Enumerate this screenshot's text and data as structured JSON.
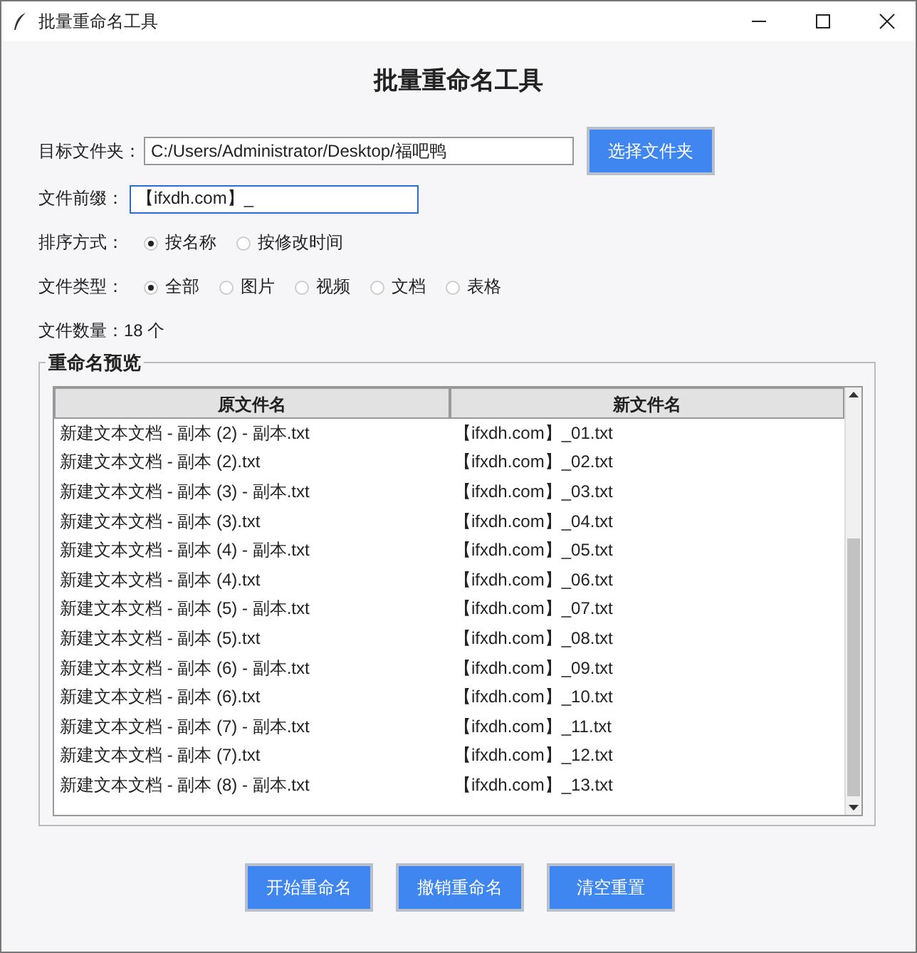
{
  "window": {
    "title": "批量重命名工具"
  },
  "heading": "批量重命名工具",
  "folder": {
    "label": "目标文件夹：",
    "value": "C:/Users/Administrator/Desktop/福吧鸭",
    "button": "选择文件夹"
  },
  "prefix": {
    "label": "文件前缀：",
    "value": "【ifxdh.com】_"
  },
  "sort": {
    "label": "排序方式：",
    "options": [
      {
        "label": "按名称",
        "selected": true
      },
      {
        "label": "按修改时间",
        "selected": false
      }
    ]
  },
  "file_type": {
    "label": "文件类型：",
    "options": [
      {
        "label": "全部",
        "selected": true
      },
      {
        "label": "图片",
        "selected": false
      },
      {
        "label": "视频",
        "selected": false
      },
      {
        "label": "文档",
        "selected": false
      },
      {
        "label": "表格",
        "selected": false
      }
    ]
  },
  "count": "文件数量：18 个",
  "preview": {
    "title": "重命名预览",
    "columns": [
      "原文件名",
      "新文件名"
    ],
    "rows": [
      [
        "新建文本文档 - 副本 (2) - 副本.txt",
        "【ifxdh.com】_01.txt"
      ],
      [
        "新建文本文档 - 副本 (2).txt",
        "【ifxdh.com】_02.txt"
      ],
      [
        "新建文本文档 - 副本 (3) - 副本.txt",
        "【ifxdh.com】_03.txt"
      ],
      [
        "新建文本文档 - 副本 (3).txt",
        "【ifxdh.com】_04.txt"
      ],
      [
        "新建文本文档 - 副本 (4) - 副本.txt",
        "【ifxdh.com】_05.txt"
      ],
      [
        "新建文本文档 - 副本 (4).txt",
        "【ifxdh.com】_06.txt"
      ],
      [
        "新建文本文档 - 副本 (5) - 副本.txt",
        "【ifxdh.com】_07.txt"
      ],
      [
        "新建文本文档 - 副本 (5).txt",
        "【ifxdh.com】_08.txt"
      ],
      [
        "新建文本文档 - 副本 (6) - 副本.txt",
        "【ifxdh.com】_09.txt"
      ],
      [
        "新建文本文档 - 副本 (6).txt",
        "【ifxdh.com】_10.txt"
      ],
      [
        "新建文本文档 - 副本 (7) - 副本.txt",
        "【ifxdh.com】_11.txt"
      ],
      [
        "新建文本文档 - 副本 (7).txt",
        "【ifxdh.com】_12.txt"
      ],
      [
        "新建文本文档 - 副本 (8) - 副本.txt",
        "【ifxdh.com】_13.txt"
      ]
    ]
  },
  "buttons": [
    "开始重命名",
    "撤销重命名",
    "清空重置"
  ]
}
